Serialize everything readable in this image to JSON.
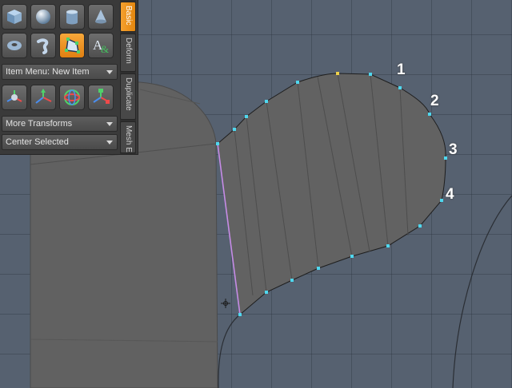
{
  "viewport": {
    "point_labels": [
      "1",
      "2",
      "3",
      "4"
    ],
    "colors": {
      "background": "#566170",
      "mesh": "#626262",
      "edge_highlight": "#c68ce6",
      "vertex": "#4fd8ef",
      "selected_vertex": "#f0d24a"
    },
    "cursor_icon": "crosshair-cursor"
  },
  "toolbox": {
    "tools_row1": [
      "cube-icon",
      "sphere-icon",
      "cylinder-icon",
      "cone-icon"
    ],
    "tools_row2": [
      "torus-icon",
      "capsule-icon",
      "pen-tool-icon",
      "text-icon"
    ],
    "active_tool": "pen-tool-icon",
    "item_menu": {
      "value": "Item Menu: New Item"
    },
    "transform_tools": [
      "move-icon",
      "rotate-icon",
      "scale-icon",
      "transform-icon"
    ],
    "more_transforms": {
      "value": "More Transforms"
    },
    "center_selected": {
      "value": "Center Selected"
    },
    "tabs": [
      {
        "label": "Basic",
        "active": true
      },
      {
        "label": "Deform",
        "active": false
      },
      {
        "label": "Duplicate",
        "active": false
      },
      {
        "label": "Mesh Ed",
        "active": false
      }
    ],
    "accent_color": "#f39a25"
  }
}
